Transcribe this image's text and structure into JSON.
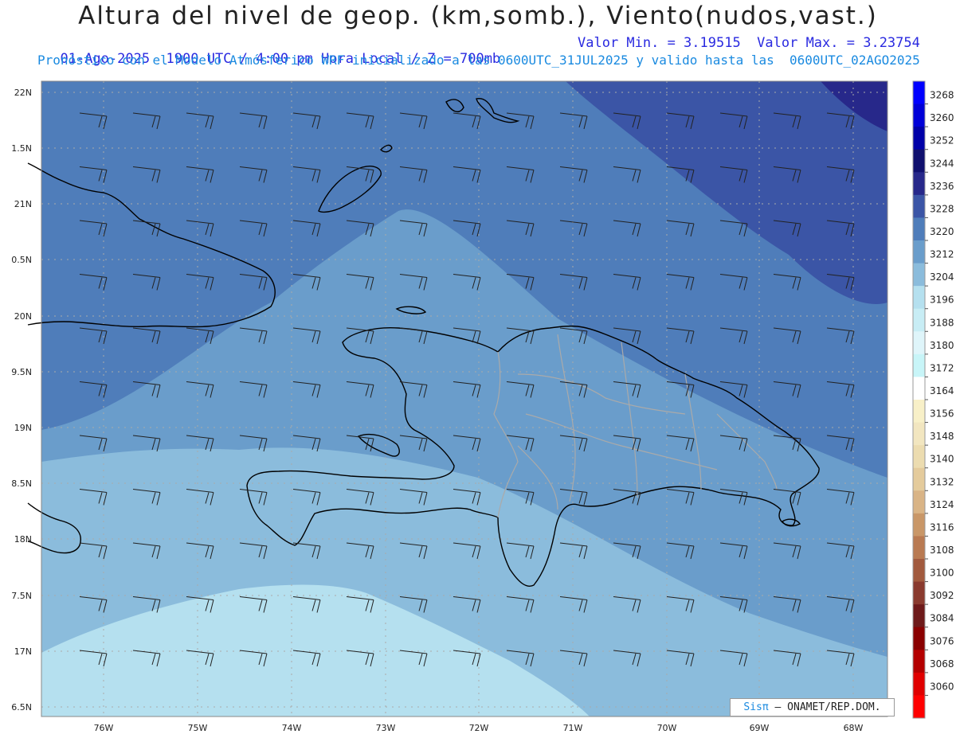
{
  "header": {
    "title": "Altura del nivel de geop. (km,somb.), Viento(nudos,vast.)",
    "date_time": "01-Ago-2025  1900 UTC / 4:00 pm Hora Local / Z = 700mb",
    "min_max": "Valor Min. = 3.19515  Valor Max. = 3.23754",
    "model_info": "Pronóstico con el Modelo Atmósferico WRF inicializado a las 0600UTC_31JUL2025 y valido hasta las  0600UTC_02AGO2025"
  },
  "map": {
    "lat_ticks": [
      "22N",
      "1.5N",
      "21N",
      "0.5N",
      "20N",
      "9.5N",
      "19N",
      "8.5N",
      "18N",
      "7.5N",
      "17N",
      "6.5N"
    ],
    "lon_ticks": [
      "76W",
      "75W",
      "74W",
      "73W",
      "72W",
      "71W",
      "70W",
      "69W",
      "68W"
    ],
    "field_colors": {
      "darkest": "#27288a",
      "dark": "#3b55a6",
      "medium": "#4f7dba",
      "light": "#6a9dcb",
      "lighter": "#8bbcdc",
      "lightest": "#b5e0ef"
    }
  },
  "colorbar": {
    "labels": [
      "3268",
      "3260",
      "3252",
      "3244",
      "3236",
      "3228",
      "3220",
      "3212",
      "3204",
      "3196",
      "3188",
      "3180",
      "3172",
      "3164",
      "3156",
      "3148",
      "3140",
      "3132",
      "3124",
      "3116",
      "3108",
      "3100",
      "3092",
      "3084",
      "3076",
      "3068",
      "3060"
    ],
    "colors": [
      "#0000ff",
      "#0000d8",
      "#0000a8",
      "#10106e",
      "#27288a",
      "#3b55a6",
      "#4f7dba",
      "#6a9dcb",
      "#8bbcdc",
      "#b5e0ef",
      "#c8edf5",
      "#dff5fa",
      "#c8f5f8",
      "#ffffff",
      "#f8f0c8",
      "#f2e6c0",
      "#ecdcb0",
      "#e4cb9c",
      "#d9b486",
      "#c99768",
      "#b97a52",
      "#a25a3e",
      "#8a3a2e",
      "#6e1a1a",
      "#8a0000",
      "#b40000",
      "#e00000",
      "#ff0000"
    ]
  },
  "credit": {
    "brand": "Sisπ",
    "org": " – ONAMET/REP.DOM."
  }
}
